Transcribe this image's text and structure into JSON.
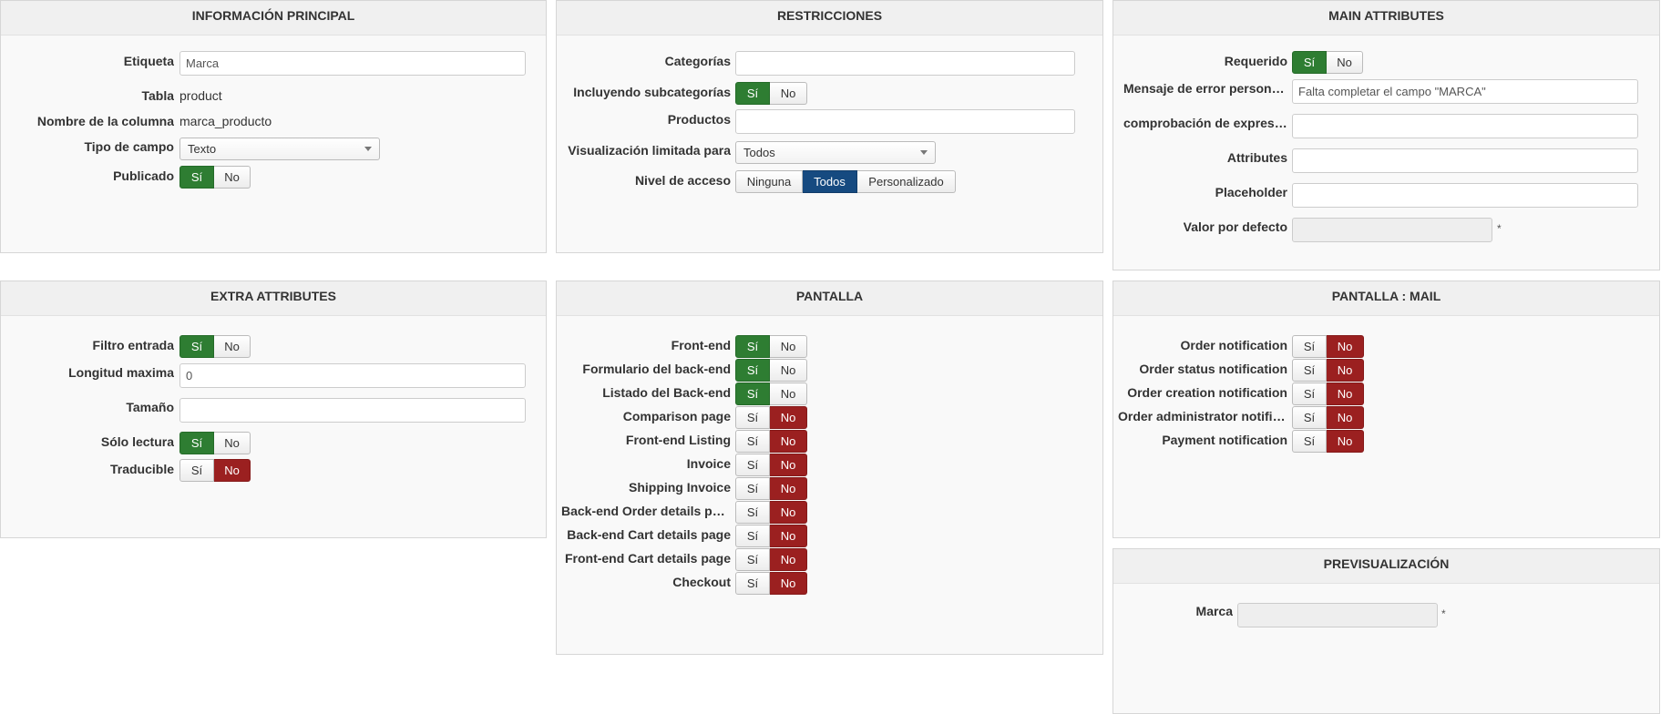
{
  "panels": {
    "info_principal": {
      "title": "INFORMACIÓN PRINCIPAL",
      "etiqueta_label": "Etiqueta",
      "etiqueta_value": "Marca",
      "tabla_label": "Tabla",
      "tabla_value": "product",
      "columna_label": "Nombre de la columna",
      "columna_value": "marca_producto",
      "tipo_label": "Tipo de campo",
      "tipo_value": "Texto",
      "publicado_label": "Publicado",
      "yes": "Sí",
      "no": "No"
    },
    "restricciones": {
      "title": "RESTRICCIONES",
      "categorias_label": "Categorías",
      "subcat_label": "Incluyendo subcategorías",
      "productos_label": "Productos",
      "visualizacion_label": "Visualización limitada para",
      "visualizacion_value": "Todos",
      "nivel_label": "Nivel de acceso",
      "nivel_options": [
        "Ninguna",
        "Todos",
        "Personalizado"
      ],
      "yes": "Sí",
      "no": "No"
    },
    "main_attributes": {
      "title": "MAIN ATTRIBUTES",
      "requerido_label": "Requerido",
      "mensaje_label": "Mensaje de error personali...",
      "mensaje_value": "Falta completar el campo \"MARCA\"",
      "regex_label": "comprobación de expresió...",
      "attributes_label": "Attributes",
      "placeholder_label": "Placeholder",
      "defecto_label": "Valor por defecto",
      "star": "*",
      "yes": "Sí",
      "no": "No"
    },
    "extra_attributes": {
      "title": "EXTRA ATTRIBUTES",
      "filtro_label": "Filtro entrada",
      "longitud_label": "Longitud maxima",
      "longitud_value": "0",
      "tamano_label": "Tamaño",
      "solo_label": "Sólo lectura",
      "traducible_label": "Traducible",
      "yes": "Sí",
      "no": "No"
    },
    "pantalla": {
      "title": "PANTALLA",
      "yes": "Sí",
      "no": "No",
      "rows": [
        {
          "label": "Front-end",
          "state": "yes"
        },
        {
          "label": "Formulario del back-end",
          "state": "yes"
        },
        {
          "label": "Listado del Back-end",
          "state": "yes"
        },
        {
          "label": "Comparison page",
          "state": "no"
        },
        {
          "label": "Front-end Listing",
          "state": "no"
        },
        {
          "label": "Invoice",
          "state": "no"
        },
        {
          "label": "Shipping Invoice",
          "state": "no"
        },
        {
          "label": "Back-end Order details page",
          "state": "no"
        },
        {
          "label": "Back-end Cart details page",
          "state": "no"
        },
        {
          "label": "Front-end Cart details page",
          "state": "no"
        },
        {
          "label": "Checkout",
          "state": "no"
        }
      ]
    },
    "pantalla_mail": {
      "title": "PANTALLA : MAIL",
      "yes": "Sí",
      "no": "No",
      "rows": [
        {
          "label": "Order notification",
          "state": "no"
        },
        {
          "label": "Order status notification",
          "state": "no"
        },
        {
          "label": "Order creation notification",
          "state": "no"
        },
        {
          "label": "Order administrator notific...",
          "state": "no"
        },
        {
          "label": "Payment notification",
          "state": "no"
        }
      ]
    },
    "previsualizacion": {
      "title": "PREVISUALIZACIÓN",
      "marca_label": "Marca",
      "star": "*"
    }
  },
  "colors": {
    "yes_active": "#2e7d32",
    "no_active": "#9b2020",
    "option_active": "#164a80"
  }
}
